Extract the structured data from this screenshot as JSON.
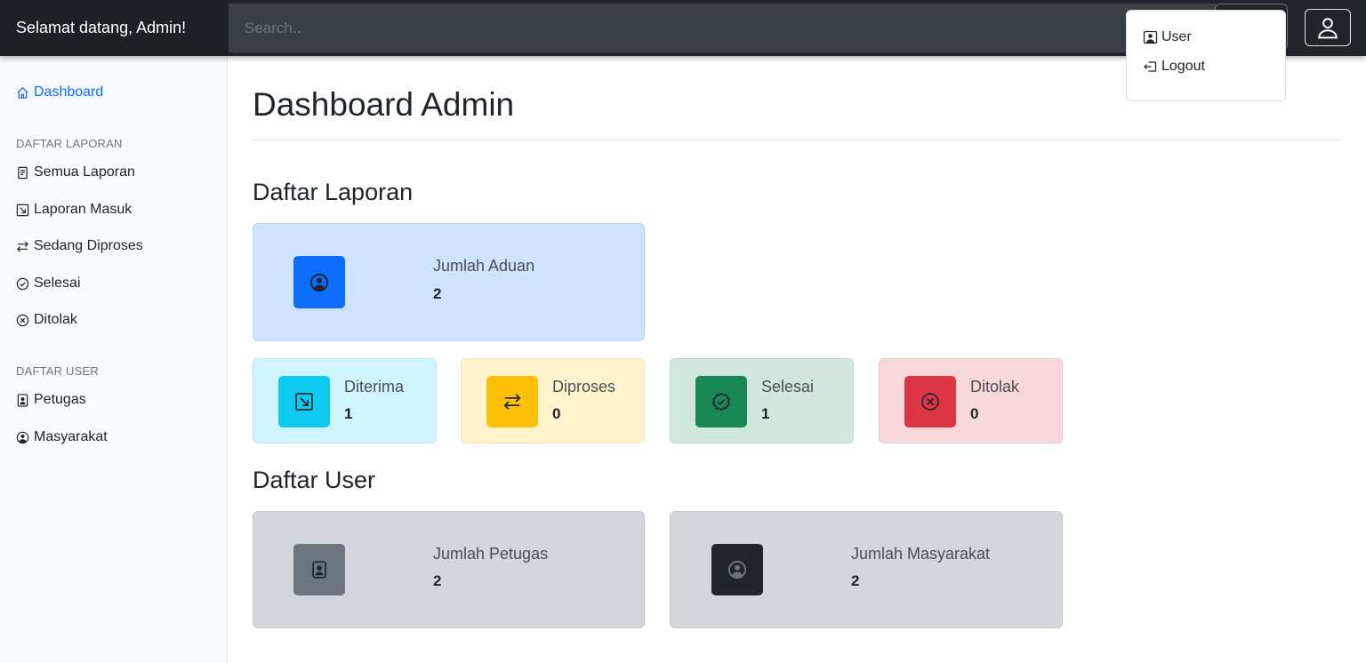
{
  "navbar": {
    "brand": "Selamat datang, Admin!",
    "search_placeholder": "Search.."
  },
  "dropdown": {
    "items": [
      {
        "label": "User",
        "icon": "person-badge-icon"
      },
      {
        "label": "Logout",
        "icon": "logout-icon"
      }
    ]
  },
  "sidebar": {
    "dashboard": "Dashboard",
    "section_laporan": "DAFTAR LAPORAN",
    "laporan_items": [
      {
        "label": "Semua Laporan",
        "icon": "file-text-icon"
      },
      {
        "label": "Laporan Masuk",
        "icon": "arrow-in-icon"
      },
      {
        "label": "Sedang Diproses",
        "icon": "arrow-left-right-icon"
      },
      {
        "label": "Selesai",
        "icon": "check-badge-icon"
      },
      {
        "label": "Ditolak",
        "icon": "x-circle-icon"
      }
    ],
    "section_user": "DAFTAR USER",
    "user_items": [
      {
        "label": "Petugas",
        "icon": "person-badge-icon"
      },
      {
        "label": "Masyarakat",
        "icon": "person-circle-icon"
      }
    ]
  },
  "main": {
    "title": "Dashboard Admin",
    "section_laporan": "Daftar Laporan",
    "section_user": "Daftar User",
    "aduan": {
      "label": "Jumlah Aduan",
      "value": "2"
    },
    "status_cards": [
      {
        "label": "Diterima",
        "value": "1",
        "color": "#0dcaf0",
        "bg": "#cff4fc"
      },
      {
        "label": "Diproses",
        "value": "0",
        "color": "#ffc107",
        "bg": "#fff3cd"
      },
      {
        "label": "Selesai",
        "value": "1",
        "color": "#198754",
        "bg": "#d1e7dd"
      },
      {
        "label": "Ditolak",
        "value": "0",
        "color": "#dc3545",
        "bg": "#f8d7da"
      }
    ],
    "petugas": {
      "label": "Jumlah Petugas",
      "value": "2"
    },
    "masyarakat": {
      "label": "Jumlah Masyarakat",
      "value": "2"
    }
  },
  "colors": {
    "primary": "#0d6efd",
    "secondary": "#6c757d",
    "dark": "#212529",
    "primary_subtle": "#cfe2ff",
    "secondary_subtle": "#d3d6db"
  }
}
